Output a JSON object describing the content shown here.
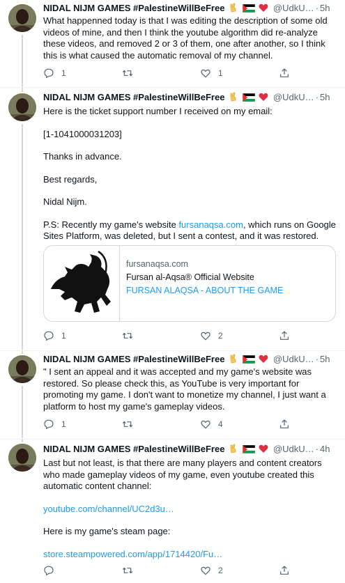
{
  "author": {
    "name": "NIDAL NIJM GAMES #PalestineWillBeFree",
    "handle": "@UdkU…",
    "emoji": [
      "victory-hand",
      "palestine-flag",
      "red-heart"
    ]
  },
  "tweets": [
    {
      "time": "5h",
      "paragraphs": [
        "What happenned today is that I was editing the description of some old videos of mine, and then I think the youtube algorithm did re-analyze these videos, and removed 2 or 3 of them, one after another, so I think this is what caused the automatic removal of my channel."
      ],
      "replies": "1",
      "retweets": "",
      "likes": "1"
    },
    {
      "time": "5h",
      "paragraphs": [
        "Here is the ticket support number I received on my email:",
        "[1-1041000031203]",
        "Thanks in advance.",
        "Best regards,",
        "Nidal Nijm."
      ],
      "ps_prefix": "P.S: Recently my game's website ",
      "ps_link": "fursanaqsa.com",
      "ps_suffix": ", which runs on Google Sites Platform, was deleted, but I sent a contest, and it was restored.",
      "card": {
        "domain": "fursanaqsa.com",
        "title": "Fursan al-Aqsa® Official Website",
        "description": "FURSAN ALAQSA - ABOUT THE GAME"
      },
      "replies": "1",
      "retweets": "",
      "likes": "2"
    },
    {
      "time": "5h",
      "paragraphs": [
        "\" I sent an appeal and it was accepted and my game's website was restored. So please check this, as YouTube is very important for promoting my game. I don't want to monetize my channel, I just want a platform to host my game's gameplay videos."
      ],
      "replies": "1",
      "retweets": "",
      "likes": "4"
    },
    {
      "time": "4h",
      "paragraphs": [
        "Last but not least, is that there are many players and content creators who made gameplay videos of my game, even youtube created this automatic content channel:"
      ],
      "link1": "youtube.com/channel/UC2d3u…",
      "middle": "Here is my game's steam page:",
      "link2": "store.steampowered.com/app/1714420/Fu…",
      "replies": "",
      "retweets": "",
      "likes": "2"
    }
  ]
}
